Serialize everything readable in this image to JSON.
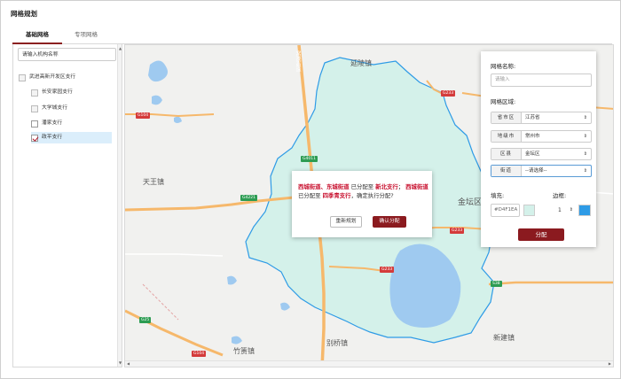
{
  "page": {
    "title": "网格规划"
  },
  "tabs": [
    {
      "label": "基础网格",
      "active": true
    },
    {
      "label": "专项网格",
      "active": false
    }
  ],
  "tree": {
    "search_placeholder": "请输入机构名称",
    "root": {
      "label": "武进高新开发区支行"
    },
    "children": [
      {
        "label": "长安家园支行",
        "state": "partial"
      },
      {
        "label": "大学城支行",
        "state": "partial"
      },
      {
        "label": "潘家支行",
        "state": "unchecked"
      },
      {
        "label": "政平支行",
        "state": "checked",
        "selected": true
      }
    ]
  },
  "map": {
    "places": [
      "延陵镇",
      "天王镇",
      "金坛区",
      "别桥镇",
      "竹箦镇",
      "新建镇"
    ],
    "roads": [
      "G104",
      "G233",
      "G4011",
      "G4221",
      "G233",
      "G233",
      "S38",
      "G25",
      "G104"
    ],
    "road_vertical": "常溧高速"
  },
  "dialog": {
    "part1_highlight": "西城街道、东城街道",
    "part1_text": "已分配至",
    "part1_branch": "新北支行",
    "sep": "；",
    "part2_highlight": "西城街道",
    "part2_text": "已分配至",
    "part2_branch": "四季青支行",
    "tail": "，确定执行分配?",
    "reset_label": "重新规划",
    "confirm_label": "确认分配"
  },
  "form": {
    "name_label": "网格名称:",
    "name_placeholder": "请输入",
    "region_label": "网格区域:",
    "rows": [
      {
        "label": "省市区",
        "value": "江苏省"
      },
      {
        "label": "地级市",
        "value": "常州市"
      },
      {
        "label": "区县",
        "value": "金坛区"
      },
      {
        "label": "街道",
        "value": "--请选择--"
      }
    ],
    "fill_label": "填充:",
    "fill_value": "#D4F1EA",
    "fill_color": "#D4F1EA",
    "border_label": "边框:",
    "border_width": "1",
    "border_color": "#2e9be6",
    "assign_label": "分配"
  }
}
